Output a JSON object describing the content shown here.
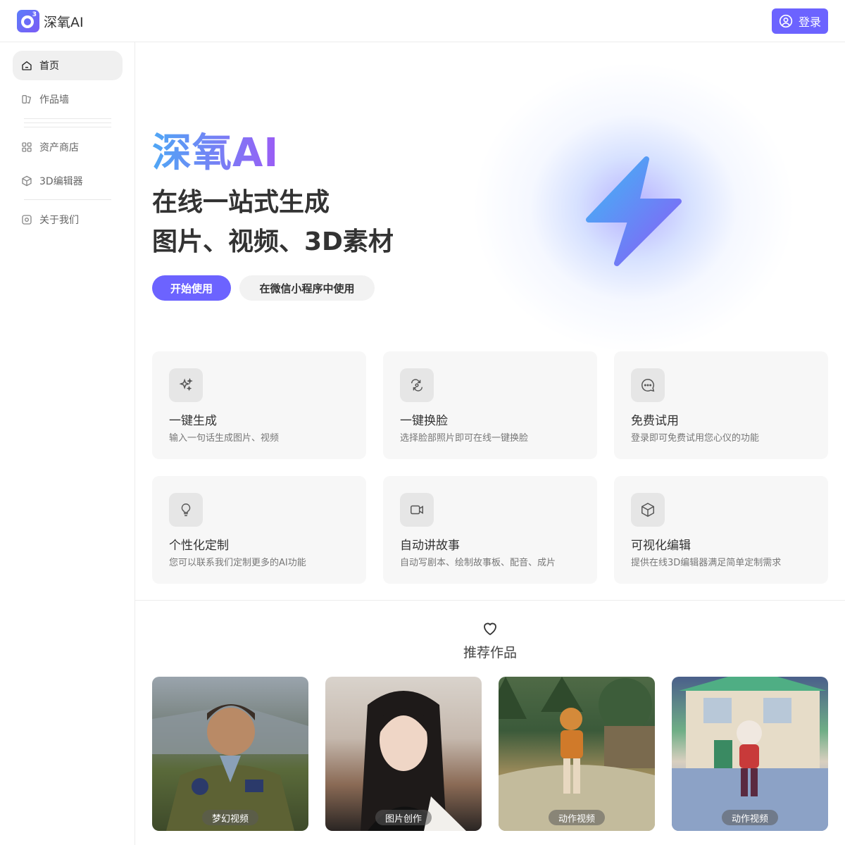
{
  "header": {
    "brand": "深氧AI",
    "logo_sup": "3",
    "login_label": "登录",
    "login_icon": "user-circle-icon"
  },
  "sidebar": {
    "items": [
      {
        "label": "首页",
        "icon": "home-icon",
        "active": true
      },
      {
        "label": "作品墙",
        "icon": "gallery-icon",
        "active": false
      },
      {
        "label": "资产商店",
        "icon": "grid-icon",
        "active": false
      },
      {
        "label": "3D编辑器",
        "icon": "cube-icon",
        "active": false
      },
      {
        "label": "关于我们",
        "icon": "info-icon",
        "active": false
      }
    ]
  },
  "hero": {
    "title": "深氧AI",
    "line1": "在线一站式生成",
    "line2": "图片、视频、3D素材",
    "primary_button": "开始使用",
    "secondary_button": "在微信小程序中使用",
    "graphic_icon": "lightning-icon"
  },
  "features": [
    {
      "title": "一键生成",
      "desc": "输入一句话生成图片、视频",
      "icon": "sparkles-icon"
    },
    {
      "title": "一键换脸",
      "desc": "选择脸部照片即可在线一键换脸",
      "icon": "swap-icon"
    },
    {
      "title": "免费试用",
      "desc": "登录即可免费试用您心仪的功能",
      "icon": "chat-icon"
    },
    {
      "title": "个性化定制",
      "desc": "您可以联系我们定制更多的AI功能",
      "icon": "lightbulb-icon"
    },
    {
      "title": "自动讲故事",
      "desc": "自动写剧本、绘制故事板、配音、成片",
      "icon": "video-icon"
    },
    {
      "title": "可视化编辑",
      "desc": "提供在线3D编辑器满足简单定制需求",
      "icon": "cube-icon"
    }
  ],
  "recommended": {
    "title": "推荐作品",
    "icon": "heart-icon",
    "works": [
      {
        "tag": "梦幻视频"
      },
      {
        "tag": "图片创作"
      },
      {
        "tag": "动作视频"
      },
      {
        "tag": "动作视频"
      }
    ]
  },
  "colors": {
    "accent": "#6c63ff",
    "gradient_start": "#4fa7f5",
    "gradient_end": "#9b5cf5"
  }
}
